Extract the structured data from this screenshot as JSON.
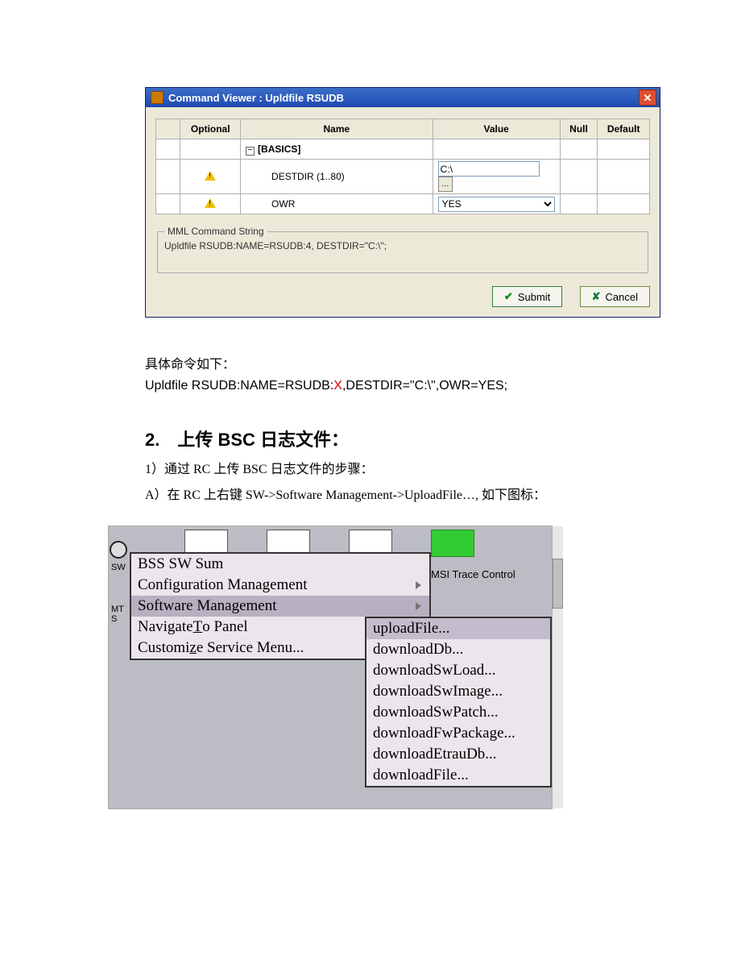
{
  "dialog": {
    "title": "Command Viewer : Upldfile RSUDB",
    "columns": {
      "optional": "Optional",
      "name": "Name",
      "value": "Value",
      "null": "Null",
      "default": "Default"
    },
    "rows": {
      "basics_label": "[BASICS]",
      "destdir": {
        "name": "DESTDIR (1..80)",
        "value": "C:\\"
      },
      "owr": {
        "name": "OWR",
        "value": "YES"
      }
    },
    "mml_legend": "MML Command String",
    "mml_text": "Upldfile RSUDB:NAME=RSUDB:4, DESTDIR=\"C:\\\";",
    "submit": "Submit",
    "cancel": "Cancel"
  },
  "body": {
    "p1": "具体命令如下：",
    "cmd_prefix": "Upldfile RSUDB:NAME=RSUDB:",
    "cmd_x": "X",
    "cmd_suffix": ",DESTDIR=\"C:\\\",OWR=YES;",
    "h2": "2.　上传 BSC 日志文件：",
    "step1": "1）通过 RC 上传 BSC 日志文件的步骤：",
    "stepA": "A）在 RC 上右键 SW->Software Management->UploadFile…, 如下图标："
  },
  "rc": {
    "side1": "SW",
    "side2": "MT S",
    "bg_label": "MSI Trace Control",
    "menu1": {
      "i0": "BSS SW Sum",
      "i1": "Configuration Management",
      "i2": "Software Management",
      "i3_pre": "Navigate ",
      "i3_u": "T",
      "i3_post": "o Panel",
      "i4_pre": "Customi",
      "i4_u": "z",
      "i4_post": "e Service Menu..."
    },
    "menu2": {
      "i0": "uploadFile...",
      "i1": "downloadDb...",
      "i2": "downloadSwLoad...",
      "i3": "downloadSwImage...",
      "i4": "downloadSwPatch...",
      "i5": "downloadFwPackage...",
      "i6": "downloadEtrauDb...",
      "i7": "downloadFile..."
    }
  }
}
